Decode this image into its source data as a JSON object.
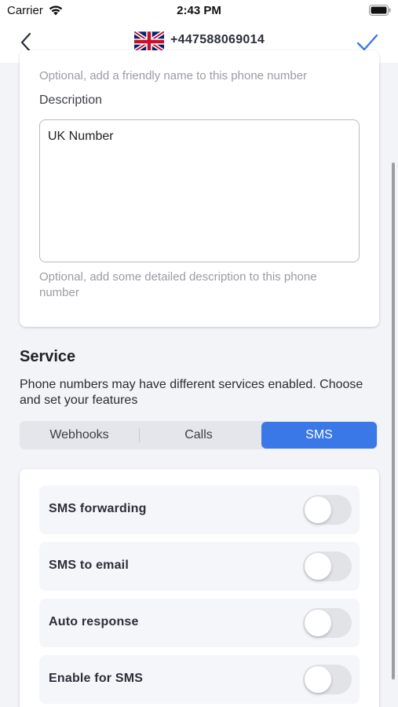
{
  "status_bar": {
    "carrier": "Carrier",
    "time": "2:43 PM"
  },
  "navbar": {
    "title": "+447588069014",
    "flag_icon": "uk-flag-icon"
  },
  "details": {
    "name_hint": "Optional, add a friendly name to this phone number",
    "description_label": "Description",
    "description_value": "UK Number",
    "description_hint": "Optional, add some detailed description to this phone number"
  },
  "service": {
    "title": "Service",
    "description": "Phone numbers may have different services enabled. Choose and set your features",
    "tabs": [
      {
        "label": "Webhooks",
        "selected": false
      },
      {
        "label": "Calls",
        "selected": false
      },
      {
        "label": "SMS",
        "selected": true
      }
    ],
    "options": [
      {
        "label": "SMS forwarding",
        "enabled": false
      },
      {
        "label": "SMS to email",
        "enabled": false
      },
      {
        "label": "Auto response",
        "enabled": false
      },
      {
        "label": "Enable for SMS",
        "enabled": false
      }
    ]
  },
  "colors": {
    "accent": "#3a78e7",
    "background": "#f3f4f8"
  }
}
